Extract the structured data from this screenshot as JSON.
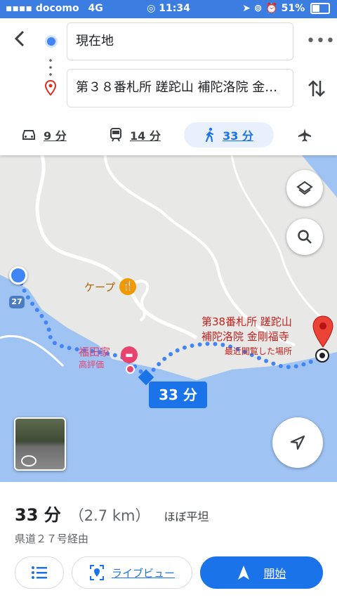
{
  "status": {
    "carrier": "docomo",
    "network": "4G",
    "time": "11:34",
    "battery": "51%",
    "battery_level": 0.51
  },
  "directions": {
    "origin": "現在地",
    "destination": "第３８番札所 蹉跎山 補陀洛院 金…"
  },
  "modes": [
    {
      "name": "car",
      "label": "9 分"
    },
    {
      "name": "transit",
      "label": "14 分"
    },
    {
      "name": "walk",
      "label": "33 分"
    },
    {
      "name": "flight",
      "label": ""
    }
  ],
  "map": {
    "route_duration_badge": "33 分",
    "road_shield": "27",
    "places": {
      "cafe": "ケープ",
      "hotel": "福田家",
      "hotel_rating": "高評価",
      "destination_line1": "第38番札所 蹉跎山",
      "destination_line2": "補陀洛院 金剛福寺",
      "destination_note": "最近閲覧した場所"
    }
  },
  "summary": {
    "duration": "33 分",
    "distance": "（2.7 km）",
    "terrain": "ほぼ平坦",
    "via": "県道２７号経由"
  },
  "actions": {
    "live_view": "ライブビュー",
    "start": "開始"
  },
  "colors": {
    "accent": "#1a73e8",
    "route": "#4285f4",
    "water": "#9fc3f2",
    "land": "#e8e8e6"
  }
}
